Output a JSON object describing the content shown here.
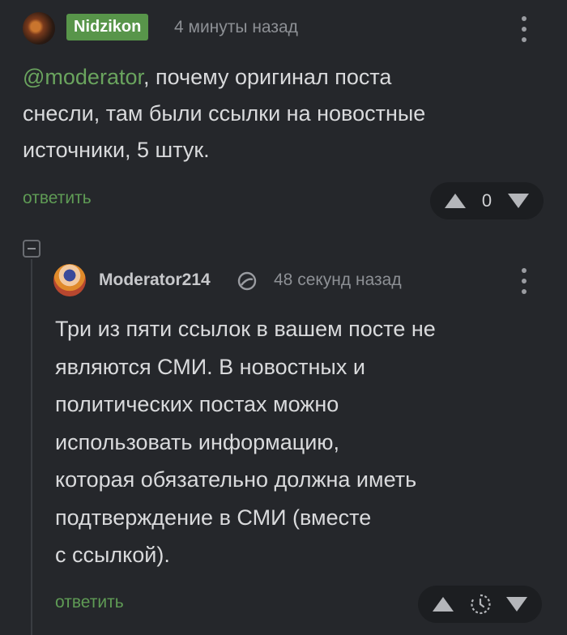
{
  "comments": [
    {
      "author": "Nidzikon",
      "time": "4 минуты назад",
      "mention": "@moderator",
      "text_line1_rest": ", почему оригинал поста",
      "text_line2": "снесли, там были ссылки на новостные",
      "text_line3": "источники, 5 штук.",
      "reply_label": "ответить",
      "score": "0",
      "icons": {
        "menu": "kebab-icon",
        "upvote": "triangle-up-icon",
        "downvote": "triangle-down-icon"
      }
    },
    {
      "author": "Moderator214",
      "time": "48 секунд назад",
      "lines": [
        "Три из пяти ссылок в вашем посте не",
        "являются СМИ. В новостных и",
        "политических постах можно",
        "использовать информацию,",
        "которая обязательно должна иметь",
        "подтверждение в СМИ (вместе",
        "с ссылкой)."
      ],
      "reply_label": "ответить",
      "icons": {
        "menu": "kebab-icon",
        "badge": "moderator-badge-icon",
        "score": "clock-icon",
        "upvote": "triangle-up-icon",
        "downvote": "triangle-down-icon"
      }
    }
  ],
  "colors": {
    "background": "#25272b",
    "accent_green": "#58954a",
    "reply_green": "#5f9b55",
    "muted": "#8d9095"
  }
}
